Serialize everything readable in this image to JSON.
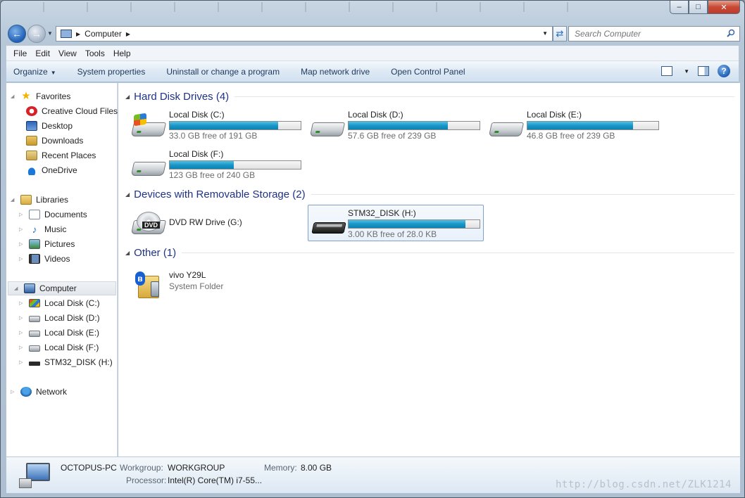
{
  "window": {
    "controls": {
      "minimize": "–",
      "maximize": "□",
      "close": "✕"
    }
  },
  "address": {
    "path": "Computer"
  },
  "search": {
    "placeholder": "Search Computer"
  },
  "menu": [
    "File",
    "Edit",
    "View",
    "Tools",
    "Help"
  ],
  "commands": {
    "organize": "Organize",
    "system_properties": "System properties",
    "uninstall": "Uninstall or change a program",
    "map_drive": "Map network drive",
    "control_panel": "Open Control Panel"
  },
  "nav": {
    "favorites": "Favorites",
    "creative_cloud": "Creative Cloud Files",
    "desktop": "Desktop",
    "downloads": "Downloads",
    "recent": "Recent Places",
    "onedrive": "OneDrive",
    "libraries": "Libraries",
    "documents": "Documents",
    "music": "Music",
    "pictures": "Pictures",
    "videos": "Videos",
    "computer": "Computer",
    "drive_c": "Local Disk (C:)",
    "drive_d": "Local Disk (D:)",
    "drive_e": "Local Disk (E:)",
    "drive_f": "Local Disk (F:)",
    "drive_h": "STM32_DISK (H:)",
    "network": "Network"
  },
  "groups": {
    "hdd": "Hard Disk Drives (4)",
    "removable": "Devices with Removable Storage (2)",
    "other": "Other (1)"
  },
  "drives": [
    {
      "name": "Local Disk (C:)",
      "free": "33.0 GB free of 191 GB",
      "used_fraction": 0.827
    },
    {
      "name": "Local Disk (D:)",
      "free": "57.6 GB free of 239 GB",
      "used_fraction": 0.759
    },
    {
      "name": "Local Disk (E:)",
      "free": "46.8 GB free of 239 GB",
      "used_fraction": 0.804
    },
    {
      "name": "Local Disk (F:)",
      "free": "123 GB free of 240 GB",
      "used_fraction": 0.488
    }
  ],
  "removable": {
    "dvd": {
      "name": "DVD RW Drive (G:)",
      "badge": "DVD"
    },
    "stm32": {
      "name": "STM32_DISK (H:)",
      "free": "3.00 KB free of 28.0 KB",
      "used_fraction": 0.893
    }
  },
  "other": {
    "name": "vivo Y29L",
    "type": "System Folder",
    "bt": "ʙ"
  },
  "details": {
    "pc_name": "OCTOPUS-PC",
    "workgroup_label": "Workgroup:",
    "workgroup": "WORKGROUP",
    "memory_label": "Memory:",
    "memory": "8.00 GB",
    "processor_label": "Processor:",
    "processor": "Intel(R) Core(TM) i7-55..."
  },
  "watermark": "http://blog.csdn.net/ZLK1214",
  "colors": {
    "accent": "#1e3287",
    "bar": "#1a96c6"
  }
}
